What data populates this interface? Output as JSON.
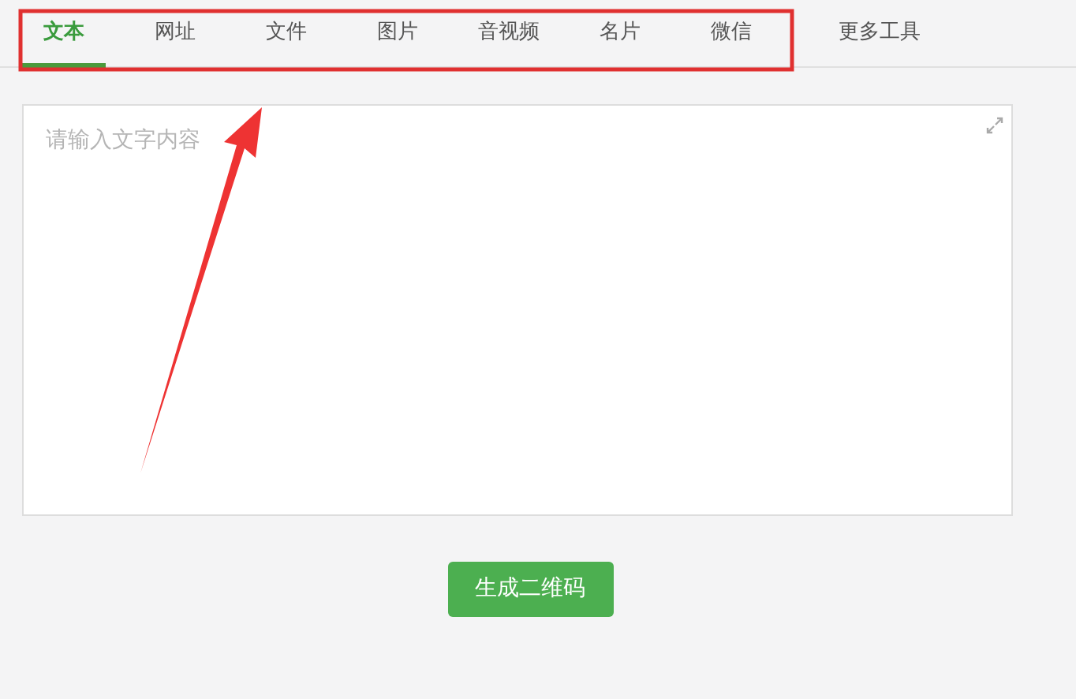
{
  "tabs": [
    {
      "label": "文本",
      "selected": true
    },
    {
      "label": "网址",
      "selected": false
    },
    {
      "label": "文件",
      "selected": false
    },
    {
      "label": "图片",
      "selected": false
    },
    {
      "label": "音视频",
      "selected": false
    },
    {
      "label": "名片",
      "selected": false
    },
    {
      "label": "微信",
      "selected": false
    },
    {
      "label": "更多工具",
      "selected": false
    }
  ],
  "editor": {
    "placeholder": "请输入文字内容"
  },
  "button": "生成二维码"
}
